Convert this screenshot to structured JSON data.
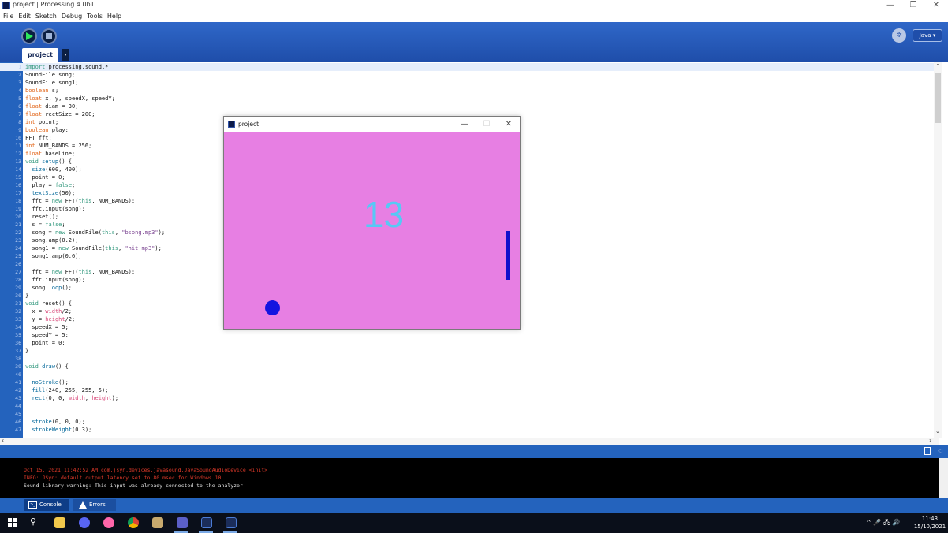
{
  "window": {
    "title": "project | Processing 4.0b1",
    "minimize": "—",
    "maximize": "❐",
    "close": "✕"
  },
  "menu": [
    "File",
    "Edit",
    "Sketch",
    "Debug",
    "Tools",
    "Help"
  ],
  "toolbar": {
    "mode": "Java ▾",
    "debug_icon": "debug-icon"
  },
  "tab": {
    "label": "project",
    "arrow": "▾"
  },
  "code_lines": [
    [
      {
        "t": "import",
        "c": "#33997e"
      },
      {
        "t": " processing.sound.*;",
        "c": "#111"
      }
    ],
    [
      {
        "t": "SoundFile song;",
        "c": "#111"
      }
    ],
    [
      {
        "t": "SoundFile song1;",
        "c": "#111"
      }
    ],
    [
      {
        "t": "boolean",
        "c": "#e2661a"
      },
      {
        "t": " s;",
        "c": "#111"
      }
    ],
    [
      {
        "t": "float",
        "c": "#e2661a"
      },
      {
        "t": " x, y, speedX, speedY;",
        "c": "#111"
      }
    ],
    [
      {
        "t": "float",
        "c": "#e2661a"
      },
      {
        "t": " diam = 30;",
        "c": "#111"
      }
    ],
    [
      {
        "t": "float",
        "c": "#e2661a"
      },
      {
        "t": " rectSize = 200;",
        "c": "#111"
      }
    ],
    [
      {
        "t": "int",
        "c": "#e2661a"
      },
      {
        "t": " point;",
        "c": "#111"
      }
    ],
    [
      {
        "t": "boolean",
        "c": "#e2661a"
      },
      {
        "t": " play;",
        "c": "#111"
      }
    ],
    [
      {
        "t": "FFT fft;",
        "c": "#111"
      }
    ],
    [
      {
        "t": "int",
        "c": "#e2661a"
      },
      {
        "t": " NUM_BANDS = 256;",
        "c": "#111"
      }
    ],
    [
      {
        "t": "float",
        "c": "#e2661a"
      },
      {
        "t": " baseLine;",
        "c": "#111"
      }
    ],
    [
      {
        "t": "void",
        "c": "#33997e"
      },
      {
        "t": " setup",
        "c": "#006699"
      },
      {
        "t": "() {",
        "c": "#111"
      }
    ],
    [
      {
        "t": "  size",
        "c": "#006699"
      },
      {
        "t": "(600, 400);",
        "c": "#111"
      }
    ],
    [
      {
        "t": "  point = 0;",
        "c": "#111"
      }
    ],
    [
      {
        "t": "  play = ",
        "c": "#111"
      },
      {
        "t": "false",
        "c": "#33997e"
      },
      {
        "t": ";",
        "c": "#111"
      }
    ],
    [
      {
        "t": "  textSize",
        "c": "#006699"
      },
      {
        "t": "(50);",
        "c": "#111"
      }
    ],
    [
      {
        "t": "  fft = ",
        "c": "#111"
      },
      {
        "t": "new",
        "c": "#33997e"
      },
      {
        "t": " FFT(",
        "c": "#111"
      },
      {
        "t": "this",
        "c": "#33997e"
      },
      {
        "t": ", NUM_BANDS);",
        "c": "#111"
      }
    ],
    [
      {
        "t": "  fft.input(song);",
        "c": "#111"
      }
    ],
    [
      {
        "t": "  reset();",
        "c": "#111"
      }
    ],
    [
      {
        "t": "  s = ",
        "c": "#111"
      },
      {
        "t": "false",
        "c": "#33997e"
      },
      {
        "t": ";",
        "c": "#111"
      }
    ],
    [
      {
        "t": "  song = ",
        "c": "#111"
      },
      {
        "t": "new",
        "c": "#33997e"
      },
      {
        "t": " SoundFile(",
        "c": "#111"
      },
      {
        "t": "this",
        "c": "#33997e"
      },
      {
        "t": ", ",
        "c": "#111"
      },
      {
        "t": "\"bsong.mp3\"",
        "c": "#7d4793"
      },
      {
        "t": ");",
        "c": "#111"
      }
    ],
    [
      {
        "t": "  song.amp(0.2);",
        "c": "#111"
      }
    ],
    [
      {
        "t": "  song1 = ",
        "c": "#111"
      },
      {
        "t": "new",
        "c": "#33997e"
      },
      {
        "t": " SoundFile(",
        "c": "#111"
      },
      {
        "t": "this",
        "c": "#33997e"
      },
      {
        "t": ", ",
        "c": "#111"
      },
      {
        "t": "\"hit.mp3\"",
        "c": "#7d4793"
      },
      {
        "t": ");",
        "c": "#111"
      }
    ],
    [
      {
        "t": "  song1.amp(0.6);",
        "c": "#111"
      }
    ],
    [],
    [
      {
        "t": "  fft = ",
        "c": "#111"
      },
      {
        "t": "new",
        "c": "#33997e"
      },
      {
        "t": " FFT(",
        "c": "#111"
      },
      {
        "t": "this",
        "c": "#33997e"
      },
      {
        "t": ", NUM_BANDS);",
        "c": "#111"
      }
    ],
    [
      {
        "t": "  fft.input(song);",
        "c": "#111"
      }
    ],
    [
      {
        "t": "  song.",
        "c": "#111"
      },
      {
        "t": "loop",
        "c": "#006699"
      },
      {
        "t": "();",
        "c": "#111"
      }
    ],
    [
      {
        "t": "}",
        "c": "#111"
      }
    ],
    [
      {
        "t": "void",
        "c": "#33997e"
      },
      {
        "t": " reset() {",
        "c": "#111"
      }
    ],
    [
      {
        "t": "  x = ",
        "c": "#111"
      },
      {
        "t": "width",
        "c": "#d94a7a"
      },
      {
        "t": "/2;",
        "c": "#111"
      }
    ],
    [
      {
        "t": "  y = ",
        "c": "#111"
      },
      {
        "t": "height",
        "c": "#d94a7a"
      },
      {
        "t": "/2;",
        "c": "#111"
      }
    ],
    [
      {
        "t": "  speedX = 5;",
        "c": "#111"
      }
    ],
    [
      {
        "t": "  speedY = 5;",
        "c": "#111"
      }
    ],
    [
      {
        "t": "  point = 0;",
        "c": "#111"
      }
    ],
    [
      {
        "t": "}",
        "c": "#111"
      }
    ],
    [],
    [
      {
        "t": "void",
        "c": "#33997e"
      },
      {
        "t": " draw",
        "c": "#006699"
      },
      {
        "t": "() {",
        "c": "#111"
      }
    ],
    [],
    [
      {
        "t": "  noStroke",
        "c": "#006699"
      },
      {
        "t": "();",
        "c": "#111"
      }
    ],
    [
      {
        "t": "  fill",
        "c": "#006699"
      },
      {
        "t": "(240, 255, 255, 5);",
        "c": "#111"
      }
    ],
    [
      {
        "t": "  rect",
        "c": "#006699"
      },
      {
        "t": "(0, 0, ",
        "c": "#111"
      },
      {
        "t": "width",
        "c": "#d94a7a"
      },
      {
        "t": ", ",
        "c": "#111"
      },
      {
        "t": "height",
        "c": "#d94a7a"
      },
      {
        "t": ");",
        "c": "#111"
      }
    ],
    [],
    [],
    [
      {
        "t": "  stroke",
        "c": "#006699"
      },
      {
        "t": "(0, 0, 0);",
        "c": "#111"
      }
    ],
    [
      {
        "t": "  strokeWeight",
        "c": "#006699"
      },
      {
        "t": "(0.3);",
        "c": "#111"
      }
    ]
  ],
  "console": {
    "lines": [
      {
        "text": "Oct 15, 2021 11:42:52 AM com.jsyn.devices.javasound.JavaSoundAudioDevice <init>",
        "color": "#e23a2a"
      },
      {
        "text": "INFO: JSyn: default output latency set to 80 msec for Windows 10",
        "color": "#e23a2a"
      },
      {
        "text": "Sound library warning: This input was already connected to the analyzer",
        "color": "#e8e8e8"
      }
    ],
    "tabs": [
      "Console",
      "Errors"
    ]
  },
  "sketch": {
    "title": "project",
    "minimize": "—",
    "maximize": "☐",
    "close": "✕",
    "score": "13",
    "background": "#e77fe3",
    "score_color": "#57c8f5"
  },
  "taskbar": {
    "time": "11:43",
    "date": "15/10/2021",
    "tray": "^ 🎤 🖧 🔊",
    "icons": [
      "windows-start-icon",
      "search-icon",
      "file-explorer-icon",
      "discord-icon",
      "osu-icon",
      "chrome-icon",
      "league-icon",
      "teams-icon",
      "processing-icon",
      "processing-sketch-icon"
    ]
  }
}
